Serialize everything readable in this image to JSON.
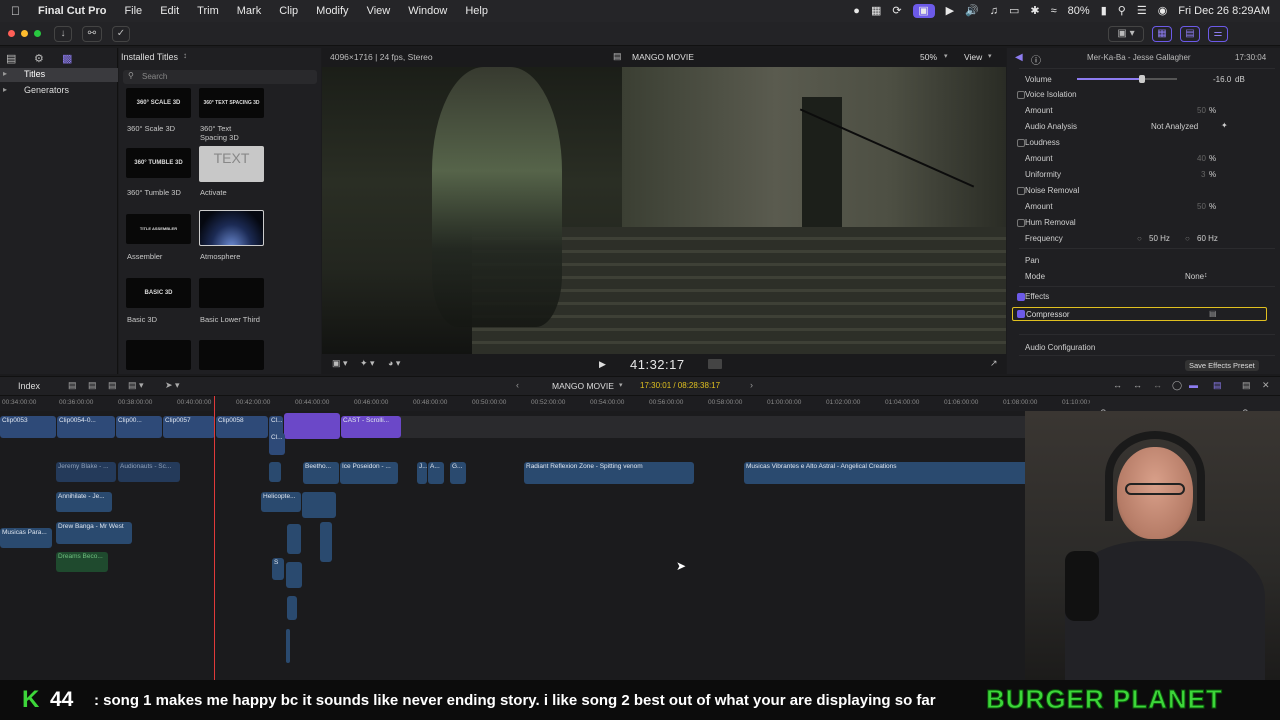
{
  "menubar": {
    "app_name": "Final Cut Pro",
    "items": [
      "File",
      "Edit",
      "Trim",
      "Mark",
      "Clip",
      "Modify",
      "View",
      "Window",
      "Help"
    ],
    "battery": "80%",
    "datetime": "Fri Dec 26  8:29AM"
  },
  "sidebar": {
    "items": [
      {
        "label": "Titles",
        "selected": true
      },
      {
        "label": "Generators",
        "selected": false
      }
    ]
  },
  "browser": {
    "header": "Installed Titles",
    "search_placeholder": "Search",
    "titles": [
      {
        "thumb_text": "360° SCALE 3D",
        "label": "360° Scale 3D"
      },
      {
        "thumb_text": "360° TEXT SPACING 3D",
        "label": "360° Text Spacing 3D"
      },
      {
        "thumb_text": "360° TUMBLE 3D",
        "label": "360° Tumble 3D"
      },
      {
        "thumb_text": "TEXT",
        "label": "Activate"
      },
      {
        "thumb_text": "TITLE ASSEMBLER",
        "label": "Assembler"
      },
      {
        "thumb_text": "",
        "label": "Atmosphere"
      },
      {
        "thumb_text": "BASIC 3D",
        "label": "Basic 3D"
      },
      {
        "thumb_text": "",
        "label": "Basic Lower Third"
      }
    ]
  },
  "viewer": {
    "format_info": "4096×1716 | 24 fps, Stereo",
    "project_name": "MANGO MOVIE",
    "zoom": "50%",
    "view_label": "View",
    "timecode": "41:32:17"
  },
  "inspector": {
    "clip_title": "Mer-Ka-Ba - Jesse Gallagher",
    "duration": "17:30:04",
    "volume_label": "Volume",
    "volume_value": "-16.0",
    "volume_unit": "dB",
    "voice_isolation": {
      "label": "Voice Isolation",
      "amount_label": "Amount",
      "amount": "50",
      "unit": "%"
    },
    "audio_analysis": {
      "label": "Audio Analysis",
      "value": "Not Analyzed"
    },
    "loudness": {
      "label": "Loudness",
      "amount_label": "Amount",
      "amount": "40",
      "uniformity_label": "Uniformity",
      "uniformity": "3",
      "unit": "%"
    },
    "noise_removal": {
      "label": "Noise Removal",
      "amount_label": "Amount",
      "amount": "50",
      "unit": "%"
    },
    "hum_removal": {
      "label": "Hum Removal",
      "frequency_label": "Frequency",
      "opt1": "50 Hz",
      "opt2": "60 Hz"
    },
    "pan": {
      "label": "Pan",
      "mode_label": "Mode",
      "mode_value": "None"
    },
    "effects_label": "Effects",
    "compressor_label": "Compressor",
    "audio_config_label": "Audio Configuration",
    "save_preset": "Save Effects Preset"
  },
  "timeline": {
    "index_label": "Index",
    "project_name": "MANGO MOVIE",
    "timecode_range": "17:30:01 / 08:28:38:17",
    "ruler": [
      "00:34:00:00",
      "00:36:00:00",
      "00:38:00:00",
      "00:40:00:00",
      "00:42:00:00",
      "00:44:00:00",
      "00:46:00:00",
      "00:48:00:00",
      "00:50:00:00",
      "00:52:00:00",
      "00:54:00:00",
      "00:56:00:00",
      "00:58:00:00",
      "01:00:00:00",
      "01:02:00:00",
      "01:04:00:00",
      "01:06:00:00",
      "01:08:00:00",
      "01:10:00:00"
    ],
    "clips": {
      "c53": "Clip0053",
      "c54": "Clip0054-0...",
      "c56": "Clip00...",
      "c57": "Clip0057",
      "c58": "Clip0058",
      "ci1": "Cl...",
      "ci2": "Cl...",
      "cast": "CAST - Scrolli...",
      "jeremy": "Jeremy Blake - ...",
      "audionauts": "Audionauts - Sc...",
      "beetho": "Beetho...",
      "poseidon": "Ice Poseidon - ...",
      "a1": "J...",
      "a2": "A...",
      "a3": "G...",
      "radiant": "Radiant Reflexion Zone - Spitting venom",
      "musicas": "Musicas Vibrantes e Alto Astral - Angelical Creations",
      "annihilate": "Annihilate - Je...",
      "helico": "Helicopte...",
      "drew": "Drew Banga - Mr West",
      "musicas_para": "Musicas Para...",
      "dreams": "Dreams Beco...",
      "s": "S"
    }
  },
  "bottom": {
    "k_label": "K",
    "k_count": "44",
    "message": ": song 1 makes me happy bc it sounds like never ending story. i like song 2 best out of what your are displaying so far",
    "brand": "BURGER PLANET"
  },
  "colors": {
    "accent": "#6c5ae8",
    "playhead": "#e03a3a",
    "video_clip": "#2e4a78",
    "title_clip": "#6b48c8",
    "brand_green": "#3dd63a"
  }
}
